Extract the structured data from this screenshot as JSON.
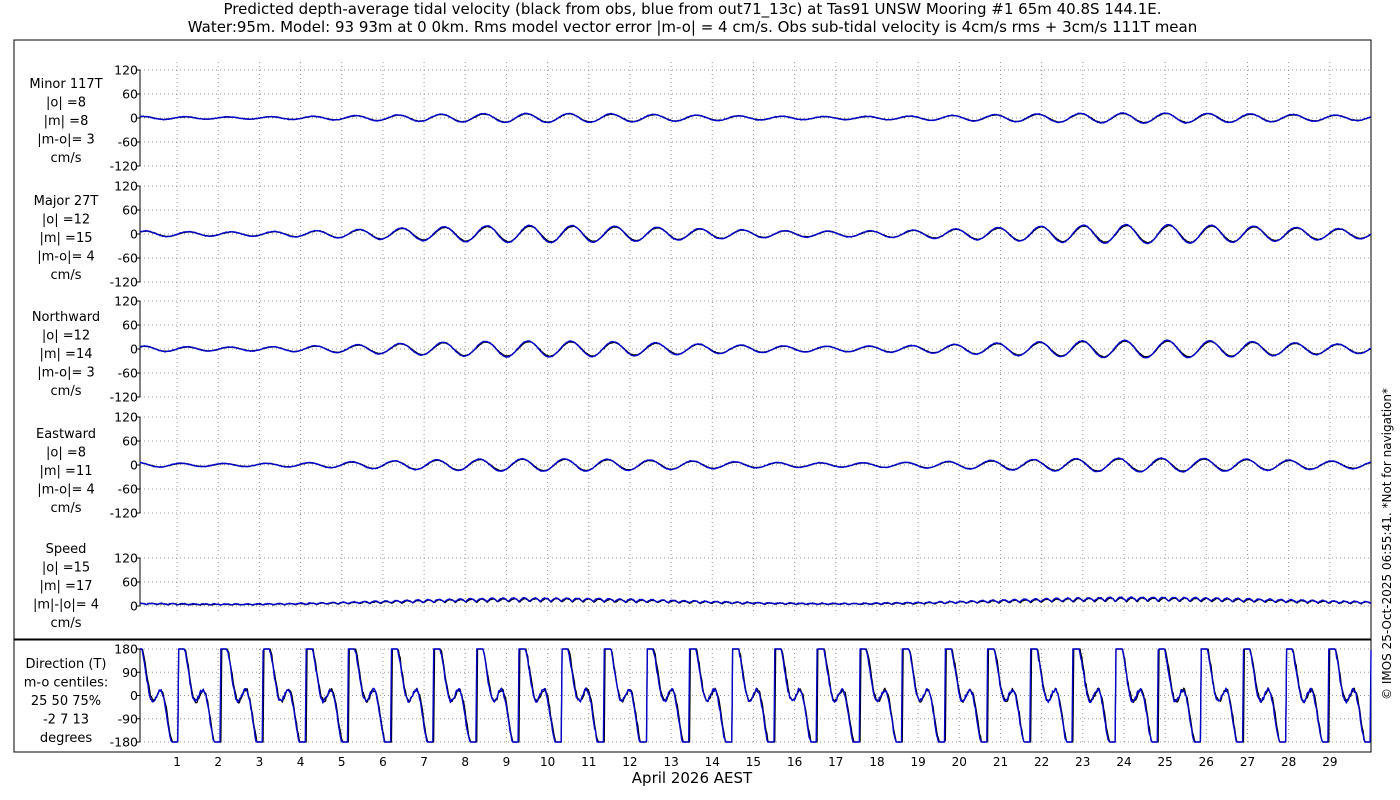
{
  "header": {
    "title_line1": "Predicted depth-average tidal velocity (black from obs, blue from out71_13c) at Tas91 UNSW Mooring #1 65m 40.8S 144.1E.",
    "title_line2": "Water:95m. Model: 93 93m at 0 0km. Rms model vector error |m-o| = 4 cm/s. Obs sub-tidal velocity is 4cm/s rms + 3cm/s 111T mean"
  },
  "footer": {
    "xlabel": "April 2026 AEST",
    "copyright": "© IMOS 25-Oct-2025 06:55:41. *Not for navigation*"
  },
  "colors": {
    "obs": "#000000",
    "model": "#0000cc",
    "grid": "#999999"
  },
  "chart_data": {
    "type": "line",
    "x_label": "April 2026 AEST",
    "x_ticks": [
      "1",
      "2",
      "3",
      "4",
      "5",
      "6",
      "7",
      "8",
      "9",
      "10",
      "11",
      "12",
      "13",
      "14",
      "15",
      "16",
      "17",
      "18",
      "19",
      "20",
      "21",
      "22",
      "23",
      "24",
      "25",
      "26",
      "27",
      "28",
      "29"
    ],
    "x_range_days": [
      0.1,
      30.0
    ],
    "grid": "dotted",
    "series_legend": {
      "obs": "black from obs",
      "model": "blue from out71_13c"
    },
    "panels": [
      {
        "id": "minor",
        "label_lines": [
          "Minor 117T",
          "|o| =8",
          "|m| =8",
          "|m-o|= 3",
          "cm/s"
        ],
        "ylim": [
          -120,
          120
        ],
        "yticks": [
          "120",
          "60",
          "0",
          "-60",
          "-120"
        ],
        "signal": {
          "kind": "tidal",
          "amp": 8,
          "phase": 0.5
        }
      },
      {
        "id": "major",
        "label_lines": [
          "Major 27T",
          "|o| =12",
          "|m| =15",
          "|m-o|= 4",
          "cm/s"
        ],
        "ylim": [
          -120,
          120
        ],
        "yticks": [
          "120",
          "60",
          "0",
          "-60",
          "-120"
        ],
        "signal": {
          "kind": "tidal",
          "amp": 15,
          "phase": 0.0
        }
      },
      {
        "id": "north",
        "label_lines": [
          "Northward",
          "|o| =12",
          "|m| =14",
          "|m-o|= 3",
          "cm/s"
        ],
        "ylim": [
          -120,
          120
        ],
        "yticks": [
          "120",
          "60",
          "0",
          "-60",
          "-120"
        ],
        "signal": {
          "kind": "tidal",
          "amp": 14,
          "phase": 0.2
        }
      },
      {
        "id": "east",
        "label_lines": [
          "Eastward",
          "|o| =8",
          "|m| =11",
          "|m-o|= 4",
          "cm/s"
        ],
        "ylim": [
          -120,
          120
        ],
        "yticks": [
          "120",
          "60",
          "0",
          "-60",
          "-120"
        ],
        "signal": {
          "kind": "tidal",
          "amp": 11,
          "phase": 1.1
        }
      },
      {
        "id": "speed",
        "label_lines": [
          "Speed",
          "|o| =15",
          "|m| =17",
          "|m|-|o|= 4",
          "cm/s"
        ],
        "ylim": [
          0,
          120
        ],
        "yticks": [
          "120",
          "60",
          "0"
        ],
        "signal": {
          "kind": "speed",
          "mean": 14,
          "amp": 10
        }
      },
      {
        "id": "direction",
        "label_lines": [
          "Direction (T)",
          "m-o centiles:",
          "25  50  75%",
          "-2   7  13",
          "degrees"
        ],
        "ylim": [
          -180,
          180
        ],
        "yticks": [
          "180",
          "90",
          "0",
          "-90",
          "-180"
        ],
        "signal": {
          "kind": "direction"
        }
      }
    ]
  }
}
